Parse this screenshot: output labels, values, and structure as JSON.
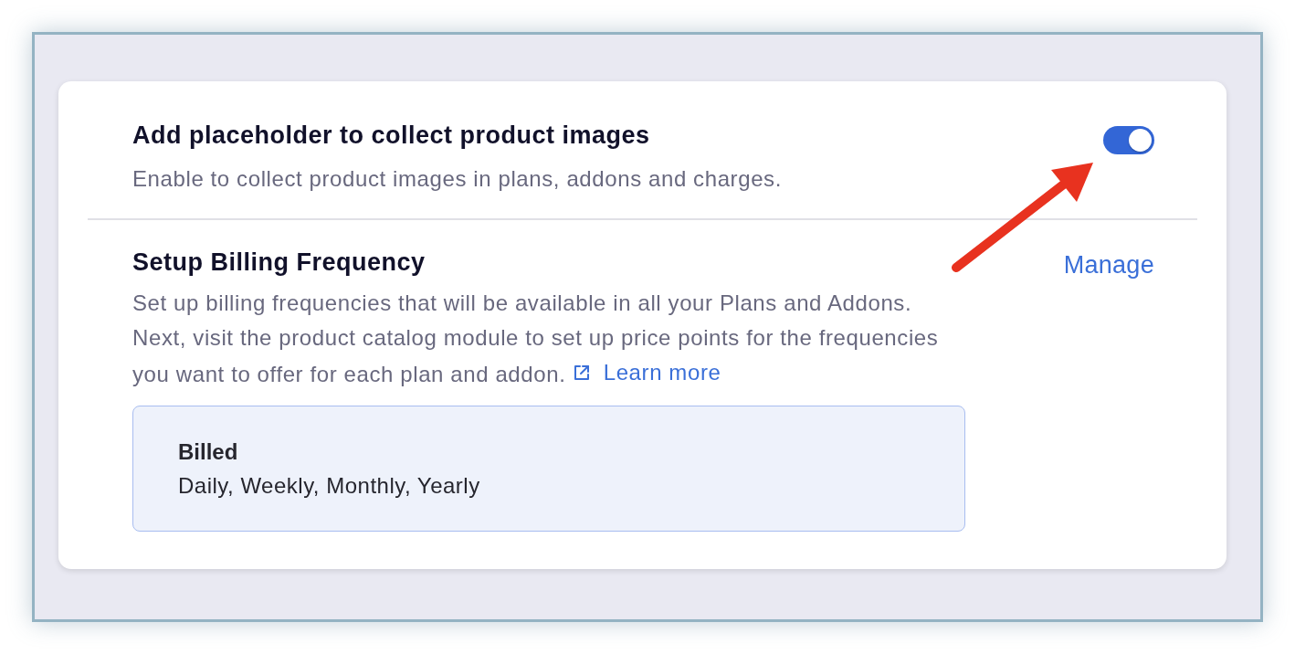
{
  "settings": [
    {
      "kind": "toggle",
      "title": "Add placeholder to collect product images",
      "description": "Enable to collect product images in plans, addons and charges.",
      "on": true
    },
    {
      "kind": "manage",
      "title": "Setup Billing Frequency",
      "action": "Manage",
      "description": "Set up billing frequencies that will be available in all your Plans and Addons. Next, visit the product catalog module to set up price points for the frequencies you want to offer for each plan and addon.",
      "link": "Learn more",
      "summary": {
        "label": "Billed",
        "value": "Daily, Weekly, Monthly, Yearly"
      }
    }
  ]
}
